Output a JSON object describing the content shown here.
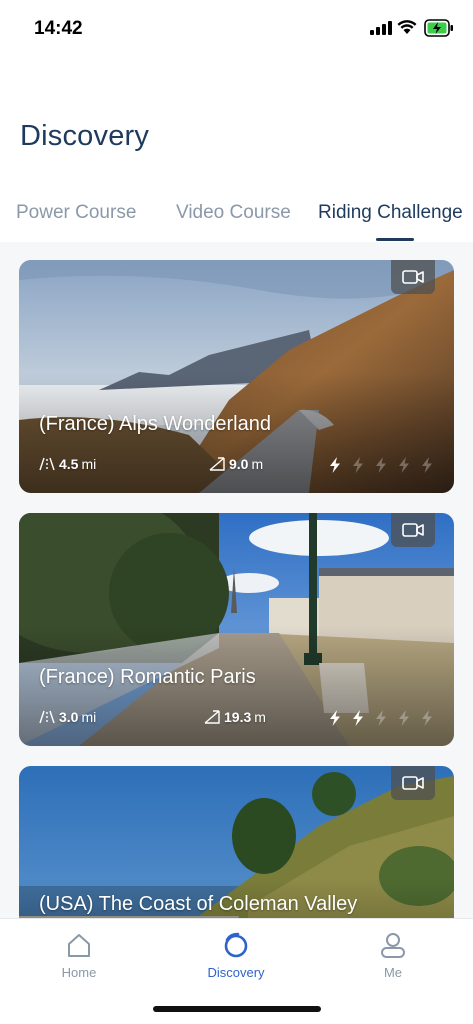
{
  "status_bar": {
    "time": "14:42"
  },
  "page": {
    "title": "Discovery"
  },
  "tabs": [
    {
      "label": "Power Course",
      "active": false
    },
    {
      "label": "Video Course",
      "active": false
    },
    {
      "label": "Riding Challenge",
      "active": true
    }
  ],
  "cards": [
    {
      "title": "(France) Alps Wonderland",
      "distance_value": "4.5",
      "distance_unit": "mi",
      "elevation_value": "9.0",
      "elevation_unit": "m",
      "intensity": 1,
      "intensity_max": 5,
      "badge_icon": "video-camera-icon"
    },
    {
      "title": "(France) Romantic Paris",
      "distance_value": "3.0",
      "distance_unit": "mi",
      "elevation_value": "19.3",
      "elevation_unit": "m",
      "intensity": 2,
      "intensity_max": 5,
      "badge_icon": "video-camera-icon"
    },
    {
      "title": "(USA) The Coast of Coleman Valley",
      "badge_icon": "video-camera-icon"
    }
  ],
  "bottom_nav": [
    {
      "label": "Home",
      "icon": "home-icon",
      "active": false
    },
    {
      "label": "Discovery",
      "icon": "discovery-icon",
      "active": true
    },
    {
      "label": "Me",
      "icon": "person-icon",
      "active": false
    }
  ],
  "colors": {
    "accent": "#2f63c9",
    "title": "#1e3b5e",
    "inactive": "#8a98a8"
  }
}
